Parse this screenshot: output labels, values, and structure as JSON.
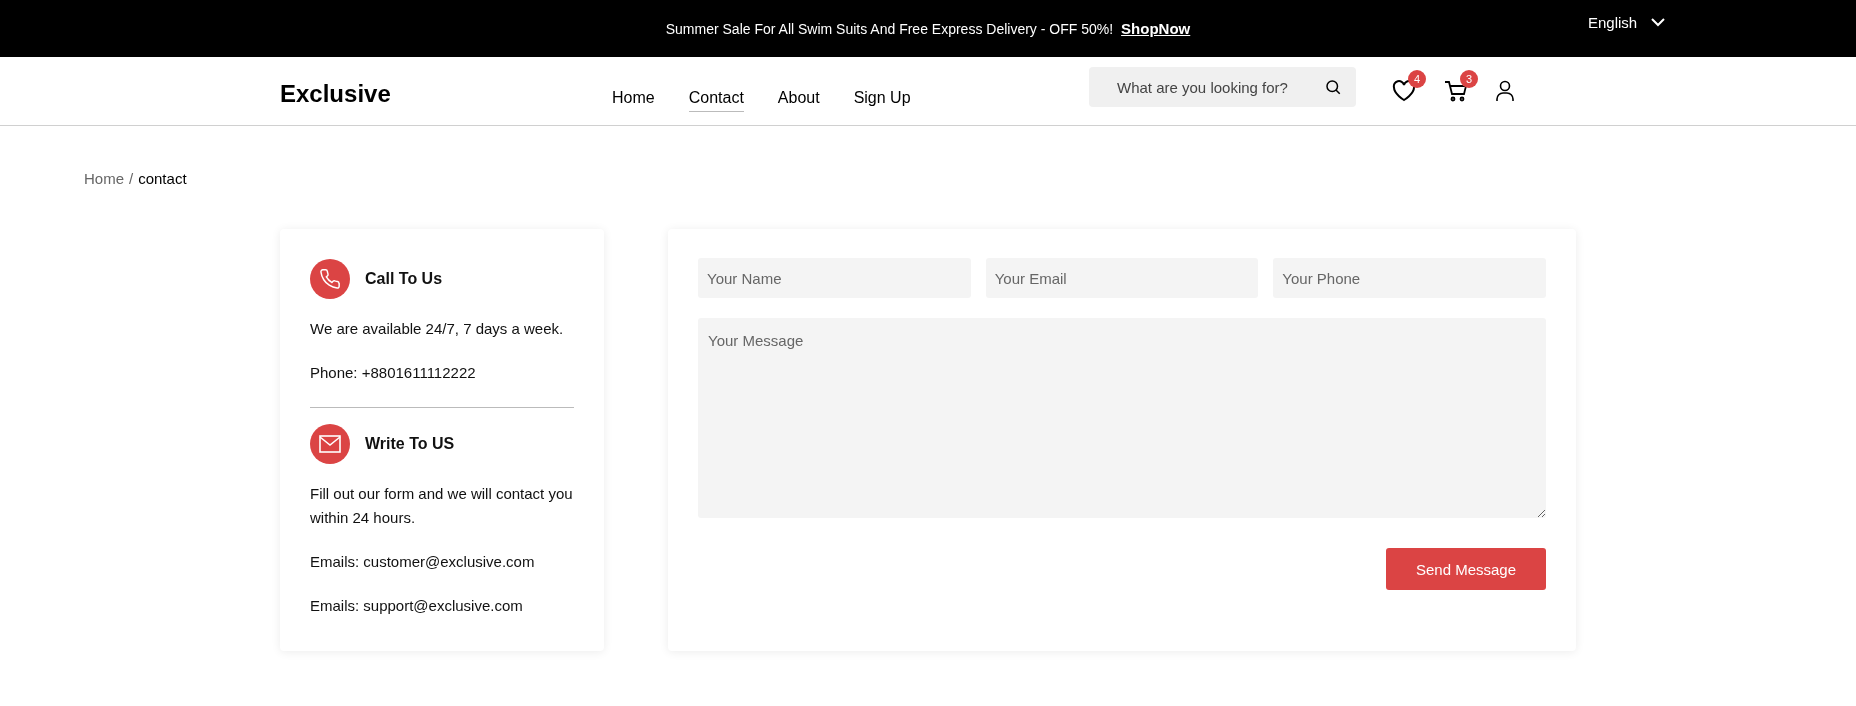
{
  "promo_bar": {
    "message": "Summer Sale For All Swim Suits And Free Express Delivery - OFF 50%!",
    "link": "ShopNow",
    "language": "English"
  },
  "header": {
    "logo": "Exclusive",
    "nav": [
      {
        "label": "Home",
        "selected": false
      },
      {
        "label": "Contact",
        "selected": true
      },
      {
        "label": "About",
        "selected": false
      },
      {
        "label": "Sign Up",
        "selected": false
      }
    ],
    "search": {
      "placeholder": "What are you looking for?"
    },
    "wishlist_count": "4",
    "cart_count": "3"
  },
  "breadcrumb": {
    "parent": "Home",
    "separator": "/",
    "current": "contact"
  },
  "contact_info": [
    {
      "kind": "phone",
      "title": "Call To Us",
      "lines": [
        "We are available 24/7, 7 days a week.",
        "Phone: +8801611112222"
      ]
    },
    {
      "kind": "mail",
      "title": "Write To US",
      "lines": [
        "Fill out our form and we will contact you within 24 hours.",
        "Emails: customer@exclusive.com",
        "Emails: support@exclusive.com"
      ]
    }
  ],
  "form": {
    "fields": [
      {
        "placeholder": "Your Name"
      },
      {
        "placeholder": "Your Email"
      },
      {
        "placeholder": "Your Phone"
      }
    ],
    "message": {
      "placeholder": "Your Message"
    },
    "submit": "Send Message"
  }
}
